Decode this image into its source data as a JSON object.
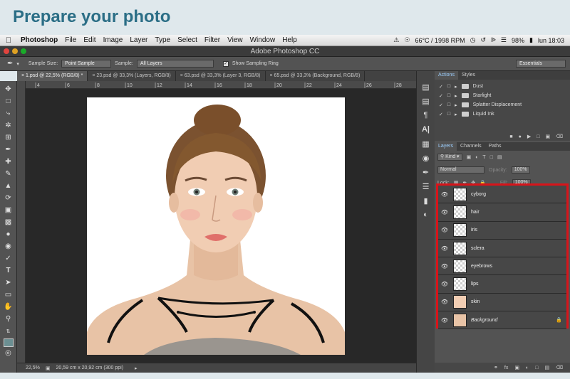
{
  "heading": "Prepare your photo",
  "menubar": {
    "apple": "",
    "items": [
      "Photoshop",
      "File",
      "Edit",
      "Image",
      "Layer",
      "Type",
      "Select",
      "Filter",
      "View",
      "Window",
      "Help"
    ],
    "temp": "66°C / 1998 RPM",
    "battery": "98%",
    "clock": "lun 18:03"
  },
  "window": {
    "title": "Adobe Photoshop CC"
  },
  "options": {
    "sample_size_label": "Sample Size:",
    "sample_size_value": "Point Sample",
    "sample_label": "Sample:",
    "sample_value": "All Layers",
    "sampling_ring": "Show Sampling Ring",
    "workspace": "Essentials"
  },
  "tabs": [
    "1.psd @ 22,5% (RGB/8) *",
    "23.psd @ 33,3% (Layers, RGB/8)",
    "63.psd @ 33,3% (Layer 3, RGB/8)",
    "65.psd @ 33,3% (Background, RGB/8)"
  ],
  "ruler_ticks": [
    "4",
    "6",
    "8",
    "10",
    "12",
    "14",
    "16",
    "18",
    "20",
    "22",
    "24",
    "26",
    "28"
  ],
  "status": {
    "zoom": "22,5%",
    "doc_size": "20,59 cm x 20,92 cm (300 ppi)"
  },
  "actions_panel": {
    "tabs": [
      "Actions",
      "Styles"
    ],
    "items": [
      "Dust",
      "Starlight",
      "Splatter Displacement",
      "Liquid Ink"
    ]
  },
  "layers_panel": {
    "tabs": [
      "Layers",
      "Channels",
      "Paths"
    ],
    "kind": "Kind",
    "blend_mode": "Normal",
    "opacity_label": "Opacity:",
    "opacity_value": "100%",
    "lock_label": "Lock:",
    "fill_label": "Fill:",
    "fill_value": "100%",
    "layers": [
      "cyborg",
      "hair",
      "iris",
      "sclera",
      "eyebrows",
      "lips",
      "skin",
      "Background"
    ]
  },
  "colors": {
    "highlight": "#d8141a",
    "heading": "#2b6e86"
  }
}
